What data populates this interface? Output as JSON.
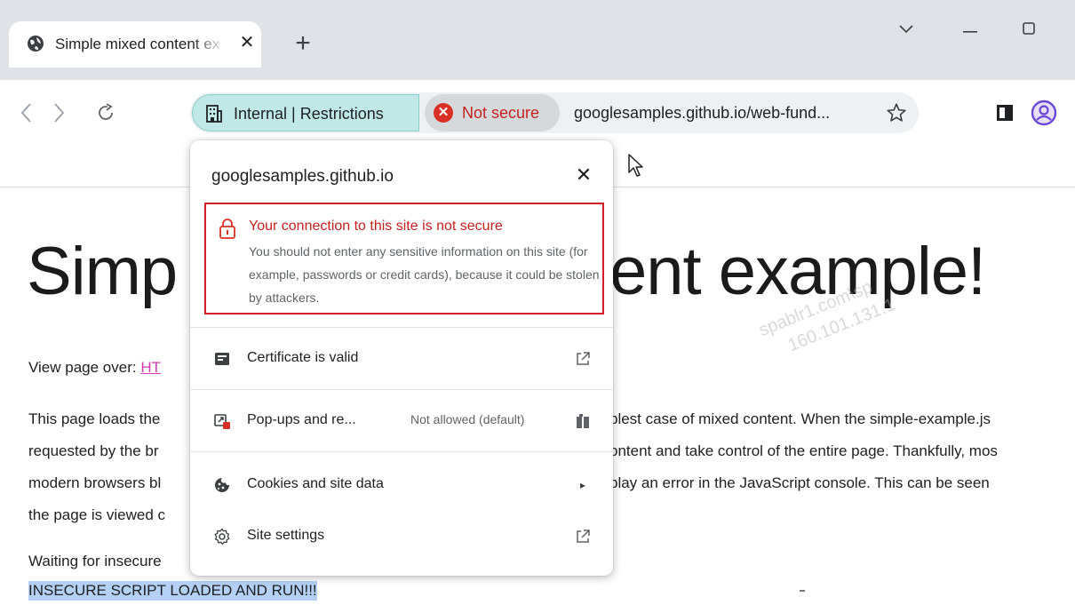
{
  "browser": {
    "tab": {
      "title": "Simple mixed content ex",
      "favicon": "globe-icon",
      "close": "✕"
    },
    "new_tab": "+",
    "window": {
      "dropdown": "⌄",
      "minimize": "—",
      "maximize": "☐"
    },
    "nav": {
      "back": "‹",
      "forward": "›",
      "reload": "⟳"
    },
    "omnibox": {
      "internal_chip": "Internal | Restrictions",
      "not_secure_label": "Not secure",
      "url": "googlesamples.github.io/web-fund...",
      "star": "star-icon"
    }
  },
  "page": {
    "title_left": "Simp",
    "title_right": "ent example!",
    "view_over_prefix": "View page over: ",
    "view_over_link": "HT",
    "paragraph_left": [
      "This page loads the",
      "requested by the br",
      "modern browsers bl",
      "the page is viewed c"
    ],
    "paragraph_right": [
      "plest case of mixed content. When the simple-example.js",
      "ontent and take control of the entire page. Thankfully, mos",
      "play an error in the JavaScript console. This can be seen"
    ],
    "waiting": "Waiting for insecure",
    "insecure_loaded": "INSECURE SCRIPT LOADED AND RUN!!!",
    "watermark": [
      "spablr1.com\\sp",
      "160.101.131.1"
    ]
  },
  "popup": {
    "domain": "googlesamples.github.io",
    "close": "✕",
    "connection": {
      "title": "Your connection to this site is not secure",
      "description": "You should not enter any sensitive information on this site (for example, passwords or credit cards), because it could be stolen by attackers."
    },
    "rows": [
      {
        "label": "Certificate is valid",
        "icon": "certificate-icon",
        "trail": "open-external-icon"
      },
      {
        "label": "Pop-ups and re...",
        "status": "Not allowed (default)",
        "icon": "popup-blocked-icon",
        "trail": "delete-icon"
      },
      {
        "label": "Cookies and site data",
        "icon": "cookie-icon",
        "trail": "▸"
      },
      {
        "label": "Site settings",
        "icon": "gear-icon",
        "trail": "open-external-icon"
      }
    ]
  },
  "colors": {
    "accent_internal": "#bfe8e6",
    "not_secure_red": "#d93025",
    "highlight_box": "#d32027",
    "selection": "#b4d1f5"
  }
}
